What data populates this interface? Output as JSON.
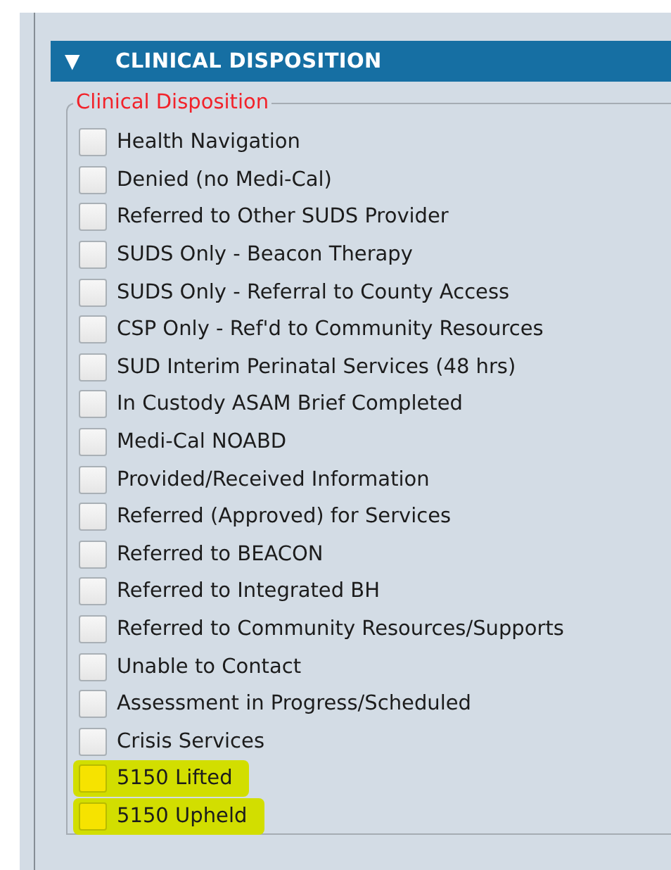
{
  "section": {
    "title": "CLINICAL DISPOSITION",
    "toggle": "▼",
    "expanded": true
  },
  "group": {
    "legend": "Clinical Disposition"
  },
  "options": [
    {
      "label": "Health Navigation",
      "checked": false,
      "highlighted": false
    },
    {
      "label": "Denied (no Medi-Cal)",
      "checked": false,
      "highlighted": false
    },
    {
      "label": "Referred to Other SUDS Provider",
      "checked": false,
      "highlighted": false
    },
    {
      "label": "SUDS Only - Beacon Therapy",
      "checked": false,
      "highlighted": false
    },
    {
      "label": "SUDS Only - Referral to County Access",
      "checked": false,
      "highlighted": false
    },
    {
      "label": "CSP Only - Ref'd to Community Resources",
      "checked": false,
      "highlighted": false
    },
    {
      "label": "SUD Interim Perinatal Services (48 hrs)",
      "checked": false,
      "highlighted": false
    },
    {
      "label": "In Custody ASAM Brief Completed",
      "checked": false,
      "highlighted": false
    },
    {
      "label": "Medi-Cal NOABD",
      "checked": false,
      "highlighted": false
    },
    {
      "label": "Provided/Received Information",
      "checked": false,
      "highlighted": false
    },
    {
      "label": "Referred (Approved) for Services",
      "checked": false,
      "highlighted": false
    },
    {
      "label": "Referred to BEACON",
      "checked": false,
      "highlighted": false
    },
    {
      "label": "Referred to Integrated BH",
      "checked": false,
      "highlighted": false
    },
    {
      "label": "Referred to Community Resources/Supports",
      "checked": false,
      "highlighted": false
    },
    {
      "label": "Unable to Contact",
      "checked": false,
      "highlighted": false
    },
    {
      "label": "Assessment in Progress/Scheduled",
      "checked": false,
      "highlighted": false
    },
    {
      "label": "Crisis Services",
      "checked": false,
      "highlighted": false
    },
    {
      "label": "5150 Lifted",
      "checked": false,
      "highlighted": true
    },
    {
      "label": "5150 Upheld",
      "checked": false,
      "highlighted": true
    }
  ]
}
